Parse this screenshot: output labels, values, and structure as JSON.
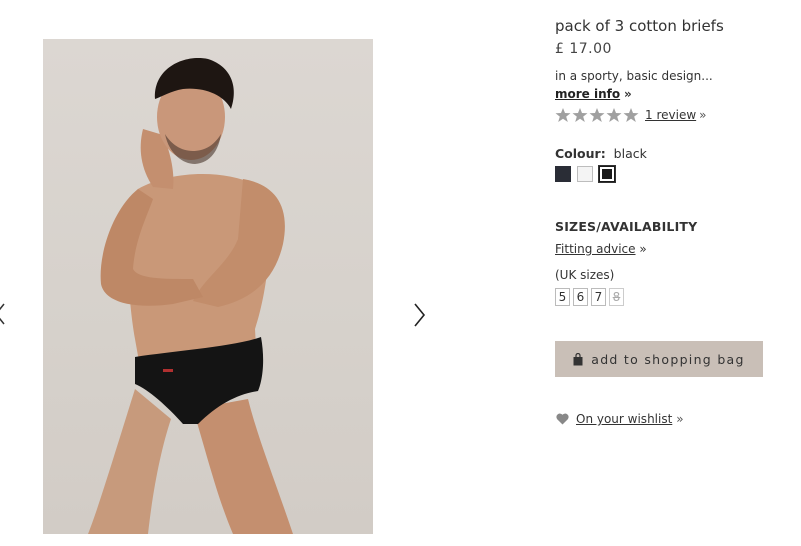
{
  "product": {
    "title": "pack of 3 cotton briefs",
    "price": "£ 17.00",
    "description": "in a sporty, basic design...",
    "more_info_label": "more info",
    "more_info_chevron": "»"
  },
  "rating": {
    "stars": 5,
    "max_stars": 5,
    "review_link": "1 review",
    "chevron": "»"
  },
  "colour": {
    "label": "Colour:",
    "selected": "black",
    "swatches": [
      {
        "name": "navy",
        "hex": "#2a2d36"
      },
      {
        "name": "white",
        "hex": "#f4f4f4"
      },
      {
        "name": "black",
        "hex": "#1a1a1a",
        "selected": true
      }
    ]
  },
  "sizes": {
    "heading": "SIZES/AVAILABILITY",
    "fitting_advice": "Fitting advice",
    "fitting_chevron": "»",
    "unit_label": "(UK sizes)",
    "options": [
      {
        "label": "5",
        "available": true
      },
      {
        "label": "6",
        "available": true
      },
      {
        "label": "7",
        "available": true
      },
      {
        "label": "8",
        "available": false
      }
    ]
  },
  "actions": {
    "add_to_bag": "add to shopping bag",
    "wishlist": "On your wishlist",
    "wishlist_chevron": "»"
  },
  "gallery": {
    "prev_icon": "chevron-left-icon",
    "next_icon": "chevron-right-icon"
  },
  "colors": {
    "button_bg": "#c9bfb7",
    "star_grey": "#a0a0a0",
    "heart_grey": "#888888"
  }
}
